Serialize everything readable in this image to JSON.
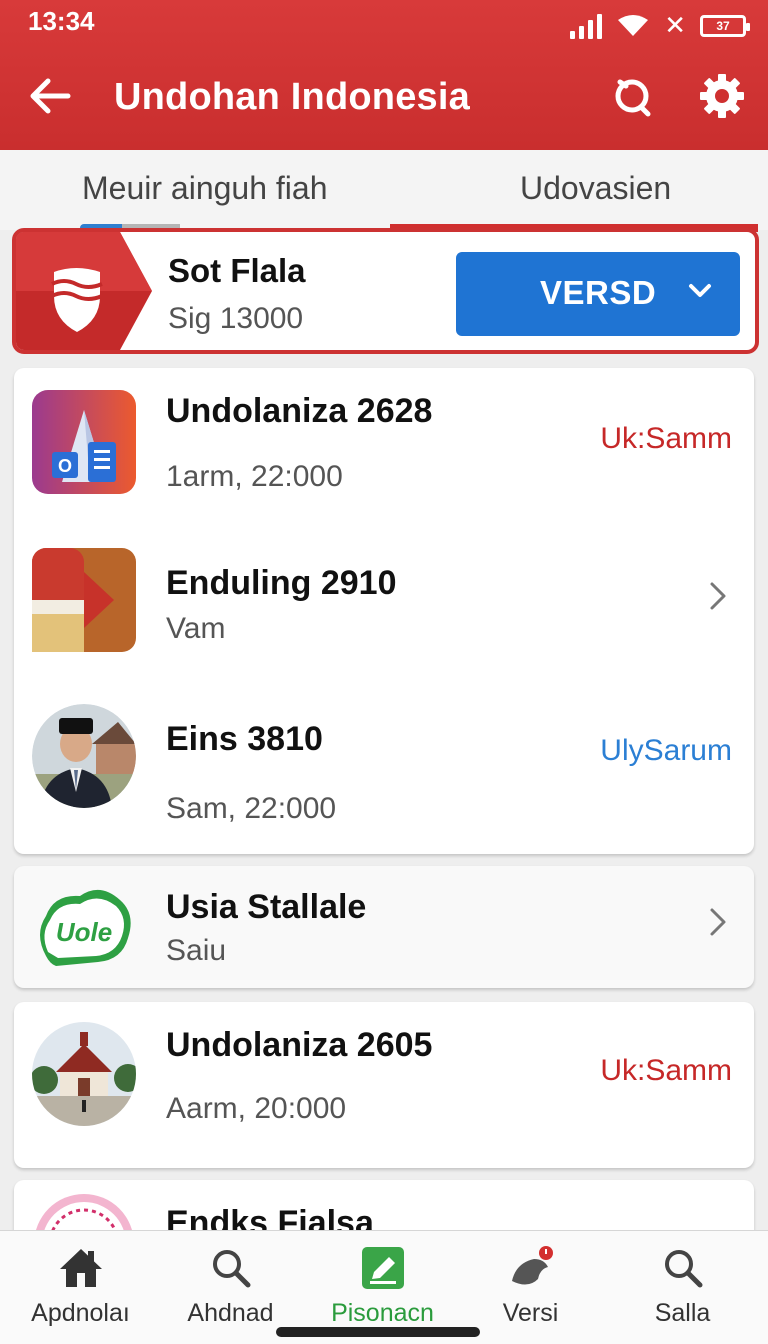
{
  "status_bar": {
    "time": "13:34",
    "battery": "37"
  },
  "header": {
    "title": "Undohan Indonesia"
  },
  "tabs": [
    {
      "label": "Meuir ainguh fiah"
    },
    {
      "label": "Udovasien"
    }
  ],
  "featured": {
    "name": "Sot Flala",
    "subtitle": "Sig 13000",
    "button_label": "VERSD"
  },
  "list": [
    {
      "name": "Undolaniza 2628",
      "subtitle": "1arm, 22:000",
      "tag": "Uk:Samm",
      "tag_color": "#c62828",
      "icon": "document-app-icon"
    },
    {
      "name": "Enduling 2910",
      "subtitle": "Vam",
      "icon": "play-app-icon"
    },
    {
      "name": "Eins 3810",
      "subtitle": "Sam, 22:000",
      "tag": "UlySarum",
      "tag_color": "#2b7fd4",
      "icon": "person-avatar"
    },
    {
      "name": "Usia Stallale",
      "subtitle": "Saiu",
      "icon": "green-cloud-logo",
      "logo_text": "Uole"
    },
    {
      "name": "Undolaniza 2605",
      "subtitle": "Aarm, 20:000",
      "tag": "Uk:Samm",
      "tag_color": "#c62828",
      "icon": "building-photo"
    },
    {
      "name": "Endks Fialsa",
      "icon": "pink-seal-logo"
    }
  ],
  "bottom_nav": [
    {
      "label": "Apdnolaı",
      "icon": "home-icon"
    },
    {
      "label": "Ahdnad",
      "icon": "search-icon"
    },
    {
      "label": "Pisonacn",
      "icon": "edit-icon",
      "active": true
    },
    {
      "label": "Versi",
      "icon": "bird-icon"
    },
    {
      "label": "Salla",
      "icon": "search-icon"
    }
  ],
  "colors": {
    "primary": "#d0312d",
    "accent_blue": "#1f74d3",
    "active_green": "#2a9b3c"
  }
}
